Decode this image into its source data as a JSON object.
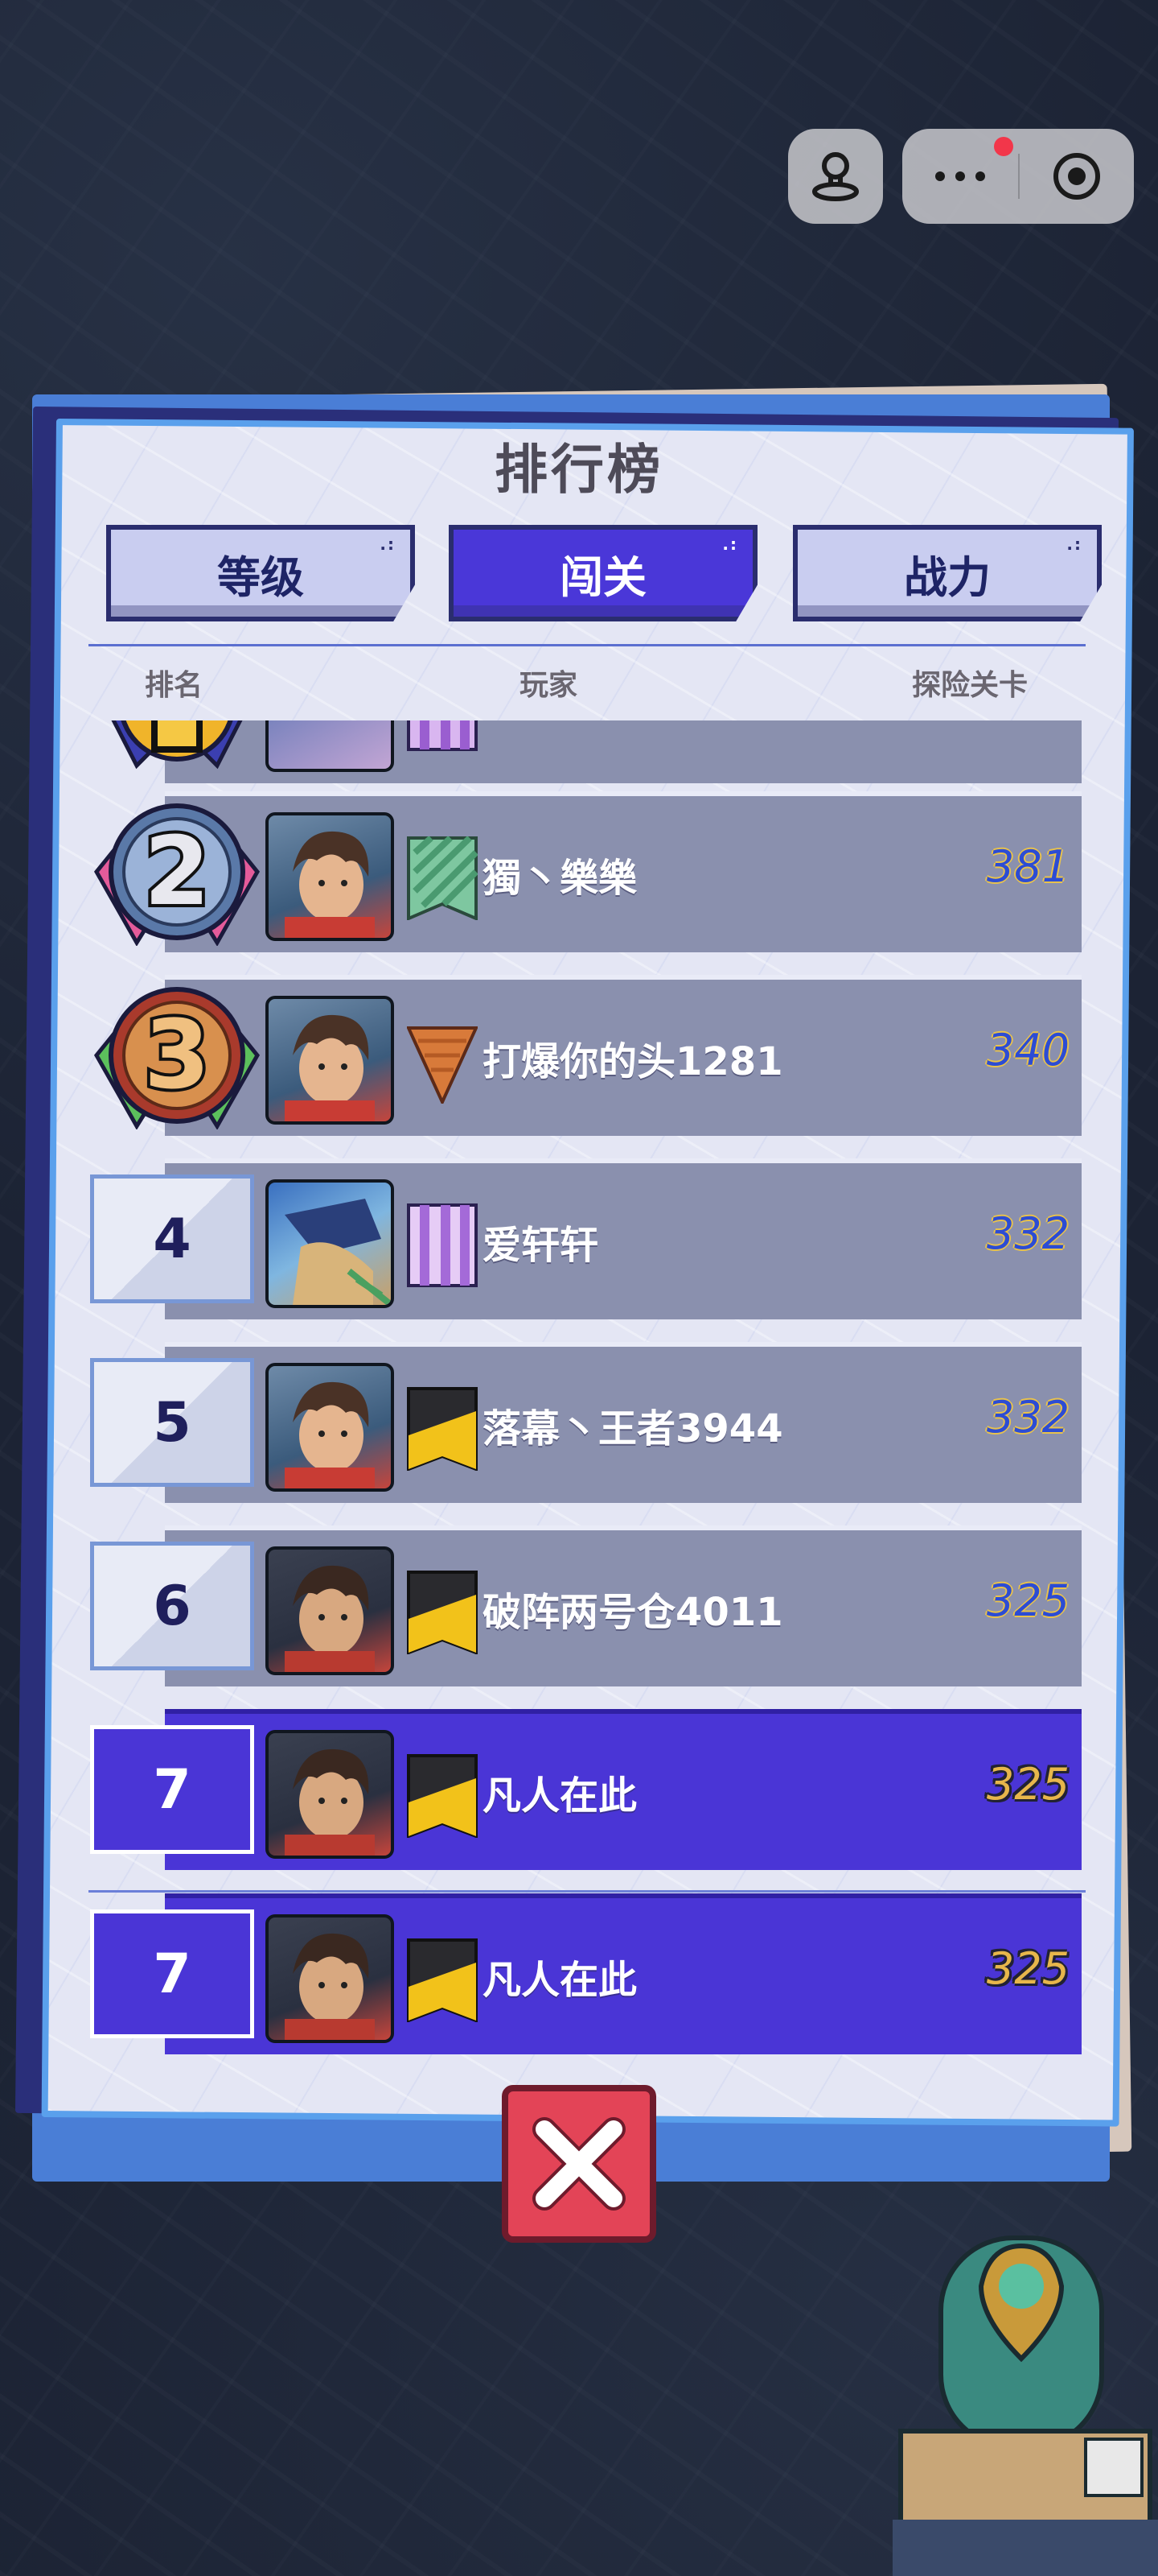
{
  "capsule": {
    "left_icon": "joystick-icon",
    "more_icon": "more-dots-icon",
    "close_icon": "target-record-icon",
    "notification_dot_color": "#f2364a"
  },
  "leaderboard": {
    "title": "排行榜",
    "tabs": [
      {
        "label": "等级",
        "active": false
      },
      {
        "label": "闯关",
        "active": true
      },
      {
        "label": "战力",
        "active": false
      }
    ],
    "columns": {
      "rank": "排名",
      "player": "玩家",
      "stage": "探险关卡"
    },
    "rows": [
      {
        "rank": "1",
        "name": "",
        "score": "",
        "medal": "gold",
        "avatar": "armored-hero",
        "flag": "purple-stripes",
        "mine": false
      },
      {
        "rank": "2",
        "name": "獨丶樂樂",
        "score": "381",
        "medal": "silver",
        "avatar": "brown-hair-hero",
        "flag": "green-diagonal",
        "mine": false
      },
      {
        "rank": "3",
        "name": "打爆你的头1281",
        "score": "340",
        "medal": "bronze",
        "avatar": "brown-hair-hero",
        "flag": "orange-pennant",
        "mine": false
      },
      {
        "rank": "4",
        "name": "爱轩轩",
        "score": "332",
        "medal": "none",
        "avatar": "armored-hero",
        "flag": "purple-stripes",
        "mine": false
      },
      {
        "rank": "5",
        "name": "落幕丶王者3944",
        "score": "332",
        "medal": "none",
        "avatar": "brown-hair-hero",
        "flag": "yellow-black",
        "mine": false
      },
      {
        "rank": "6",
        "name": "破阵两号仓4011",
        "score": "325",
        "medal": "none",
        "avatar": "dark-hero",
        "flag": "yellow-black",
        "mine": false
      },
      {
        "rank": "7",
        "name": "凡人在此",
        "score": "325",
        "medal": "none",
        "avatar": "dark-hero",
        "flag": "yellow-black",
        "mine": true
      }
    ],
    "my_row": {
      "rank": "7",
      "name": "凡人在此",
      "score": "325",
      "avatar": "dark-hero",
      "flag": "yellow-black"
    },
    "close_icon": "close-x-icon"
  },
  "colors": {
    "panel_border": "#5aa0ec",
    "active_tab": "#4a37d8",
    "row_bg": "#8a90ae",
    "mine_row_bg": "#4a35d6",
    "score_gold": "#e7b64b",
    "close_button": "#e34457"
  }
}
